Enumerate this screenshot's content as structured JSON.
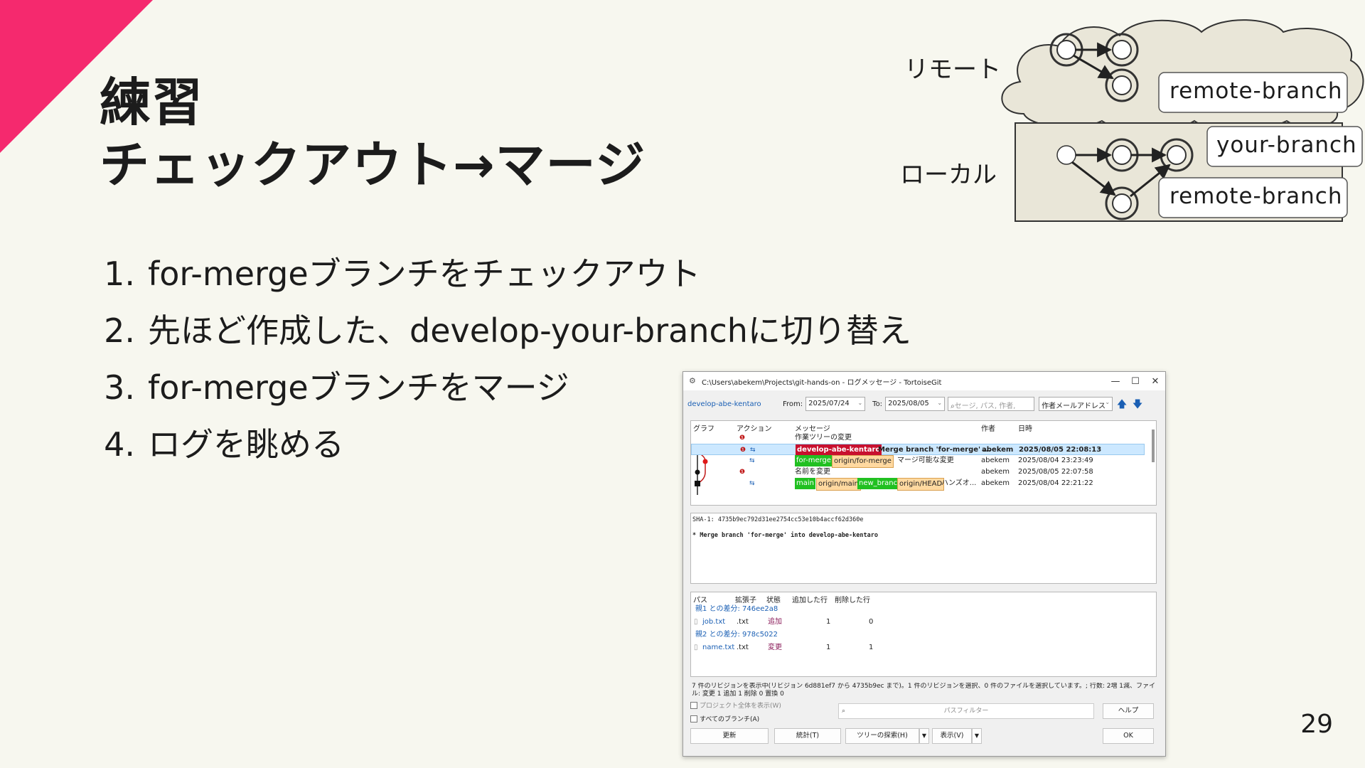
{
  "slide": {
    "title_line1": "練習",
    "title_line2": "チェックアウト→マージ",
    "steps": [
      {
        "num": "1.",
        "text": "for-mergeブランチをチェックアウト"
      },
      {
        "num": "2.",
        "text": "先ほど作成した、develop-your-branchに切り替え"
      },
      {
        "num": "3.",
        "text": "for-mergeブランチをマージ"
      },
      {
        "num": "4.",
        "text": "ログを眺める"
      }
    ],
    "page_number": "29",
    "accent_color": "#f5296e"
  },
  "diagram": {
    "remote_label": "リモート",
    "local_label": "ローカル",
    "remote_branch_tag": "remote-branch",
    "local_your_branch_tag": "your-branch",
    "local_remote_branch_tag": "remote-branch"
  },
  "window": {
    "title": "C:\\Users\\abekem\\Projects\\git-hands-on - ログメッセージ - TortoiseGit",
    "current_branch": "develop-abe-kentaro",
    "from_label": "From:",
    "from_date": "2025/07/24",
    "to_label": "To:",
    "to_date": "2025/08/05",
    "search_placeholder": "セージ, パス, 作者, ",
    "filter_select": "作者メールアドレス",
    "log_headers": {
      "graph": "グラフ",
      "action": "アクション",
      "message": "メッセージ",
      "author": "作者",
      "date": "日時"
    },
    "log_rows": [
      {
        "message": "作業ツリーの変更",
        "author": "",
        "date": ""
      },
      {
        "tag1": "develop-abe-kentaro",
        "message": "Merge branch 'for-merge' ...",
        "author": "abekem",
        "date": "2025/08/05 22:08:13"
      },
      {
        "tag1": "for-merge",
        "tag2": "origin/for-merge",
        "message": "マージ可能な変更",
        "author": "abekem",
        "date": "2025/08/04 23:23:49"
      },
      {
        "message": "名前を変更",
        "author": "abekem",
        "date": "2025/08/05 22:07:58"
      },
      {
        "tag1": "main",
        "tag2": "origin/main",
        "tag3": "new_branch",
        "tag4": "origin/HEAD",
        "message": "ハンズオ...",
        "author": "abekem",
        "date": "2025/08/04 22:21:22"
      }
    ],
    "detail_sha": "SHA-1: 4735b9ec792d31ee2754cc53e10b4accf62d360e",
    "detail_message": "* Merge branch 'for-merge' into develop-abe-kentaro",
    "file_headers": {
      "path": "パス",
      "ext": "拡張子",
      "state": "状態",
      "added": "追加した行",
      "deleted": "削除した行"
    },
    "file_groups": [
      {
        "parent": "親1 との差分: 746ee2a8",
        "file": "job.txt",
        "ext": ".txt",
        "state": "追加",
        "added": "1",
        "deleted": "0"
      },
      {
        "parent": "親2 との差分: 978c5022",
        "file": "name.txt",
        "ext": ".txt",
        "state": "変更",
        "added": "1",
        "deleted": "1"
      }
    ],
    "status_text": "7 件のリビジョンを表示中(リビジョン 6d881ef7 から 4735b9ec まで)。1 件のリビジョンを選択、0 件のファイルを選択しています。; 行数: 2増 1減、ファイル: 変更  1 追加  1 削除  0 置換  0",
    "checkbox_project": "プロジェクト全体を表示(W)",
    "checkbox_all_branches": "すべてのブランチ(A)",
    "path_filter_placeholder": "パスフィルター",
    "btn_help": "ヘルプ",
    "btn_refresh": "更新",
    "btn_stats": "統計(T)",
    "btn_tree_search": "ツリーの探索(H)",
    "btn_view": "表示(V)",
    "btn_ok": "OK"
  }
}
